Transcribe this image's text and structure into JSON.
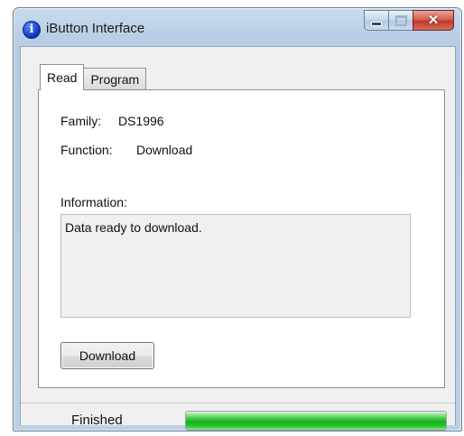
{
  "window": {
    "title": "iButton Interface",
    "icon": "info-icon",
    "icon_glyph": "i",
    "close_glyph": "✕"
  },
  "tabs": [
    {
      "label": "Read",
      "active": true
    },
    {
      "label": "Program",
      "active": false
    }
  ],
  "read": {
    "family_label": "Family:",
    "family_value": "DS1996",
    "function_label": "Function:",
    "function_value": "Download",
    "information_label": "Information:",
    "information_text": "Data ready to download.",
    "download_button": "Download"
  },
  "status": {
    "text": "Finished",
    "progress_percent": 100,
    "progress_color": "#16b21a"
  }
}
